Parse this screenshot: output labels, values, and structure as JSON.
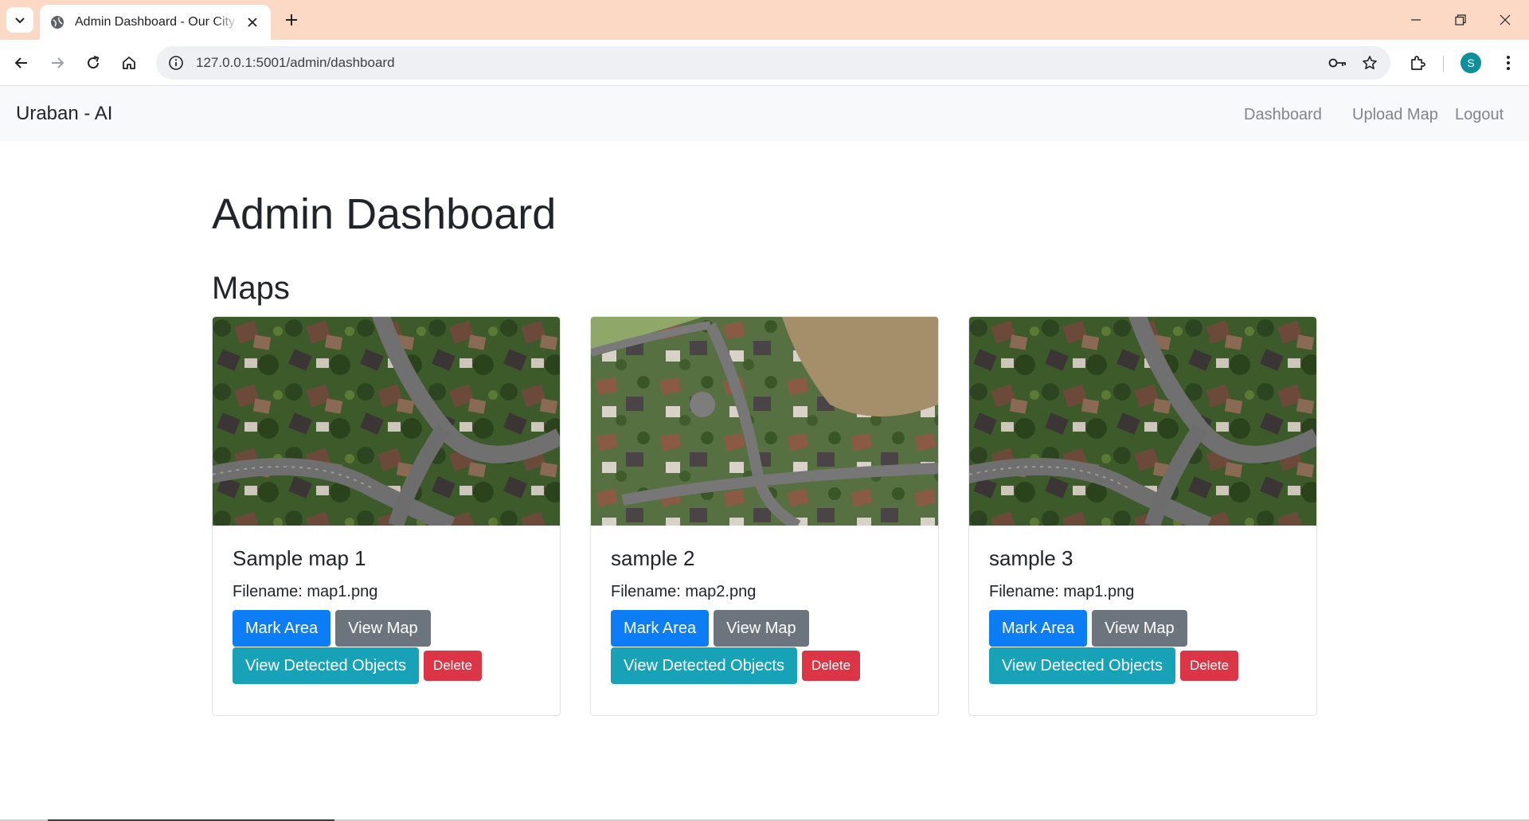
{
  "browser": {
    "tab_title": "Admin Dashboard - Our City Planner",
    "url": "127.0.0.1:5001/admin/dashboard",
    "profile_initial": "S"
  },
  "navbar": {
    "brand": "Uraban - AI",
    "links": [
      "Dashboard",
      "Upload Map",
      "Logout"
    ]
  },
  "page": {
    "title": "Admin Dashboard",
    "section_title": "Maps"
  },
  "maps": [
    {
      "title": "Sample map 1",
      "filename": "Filename: map1.png",
      "buttons": {
        "mark": "Mark Area",
        "view": "View Map",
        "detected": "View Detected Objects",
        "delete": "Delete"
      }
    },
    {
      "title": "sample 2",
      "filename": "Filename: map2.png",
      "buttons": {
        "mark": "Mark Area",
        "view": "View Map",
        "detected": "View Detected Objects",
        "delete": "Delete"
      }
    },
    {
      "title": "sample 3",
      "filename": "Filename: map1.png",
      "buttons": {
        "mark": "Mark Area",
        "view": "View Map",
        "detected": "View Detected Objects",
        "delete": "Delete"
      }
    }
  ],
  "colors": {
    "tab_strip": "#fcd9c5",
    "primary": "#0d7df5",
    "secondary": "#6c757d",
    "info": "#17a2b8",
    "danger": "#dc3545"
  }
}
